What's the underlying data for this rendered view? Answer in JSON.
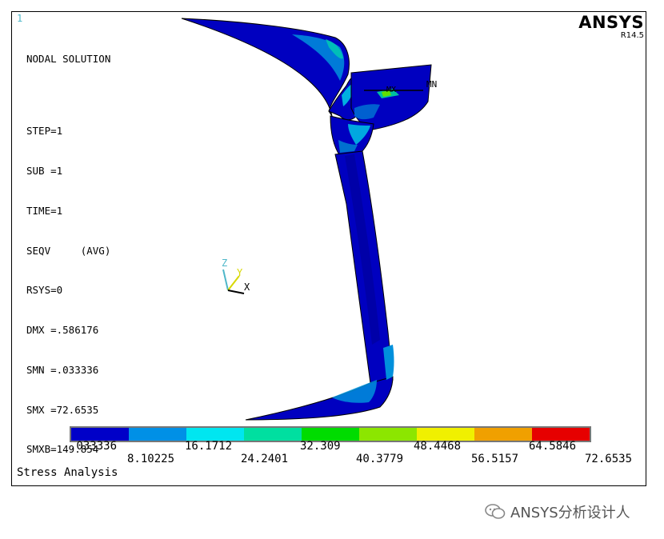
{
  "window_number": "1",
  "info_lines_top": [
    "NODAL SOLUTION"
  ],
  "info_lines": [
    "STEP=1",
    "SUB =1",
    "TIME=1",
    "SEQV     (AVG)",
    "RSYS=0",
    "DMX =.586176",
    "SMN =.033336",
    "SMX =72.6535",
    "SMXB=149.854"
  ],
  "logo": {
    "title": "ANSYS",
    "release": "R14.5"
  },
  "markers": {
    "min": "MN",
    "max": "MX"
  },
  "triad": {
    "x": "X",
    "y": "Y",
    "z": "Z"
  },
  "legend": {
    "colors": [
      "#0000c8",
      "#0090e6",
      "#00e6f0",
      "#00dfa0",
      "#00dc00",
      "#8ce600",
      "#f0f000",
      "#f0a000",
      "#e60000"
    ],
    "labels_top": [
      ".033336",
      "16.1712",
      "32.309",
      "48.4468",
      "64.5846"
    ],
    "labels_bottom": [
      "8.10225",
      "24.2401",
      "40.3779",
      "56.5157",
      "72.6535"
    ]
  },
  "caption": "Stress Analysis",
  "watermark": "ANSYS分析设计人"
}
